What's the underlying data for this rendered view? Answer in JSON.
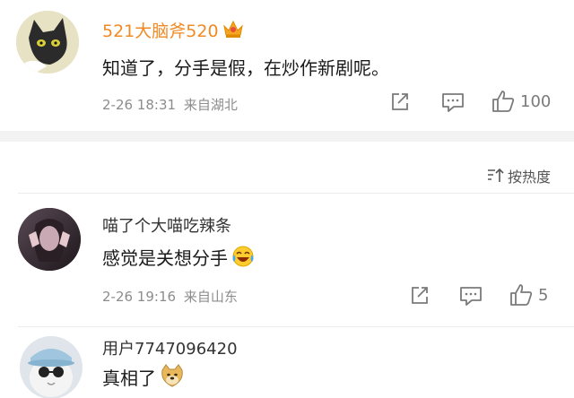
{
  "comments": [
    {
      "username": "521大脑斧520",
      "username_color": "#f08a24",
      "vip_badge": "crown-icon",
      "text": "知道了，分手是假，在炒作新剧呢。",
      "time": "2-26 18:31",
      "location": "来自湖北",
      "likes": "100"
    },
    {
      "username": "喵了个大喵吃辣条",
      "username_color": "#333333",
      "text": "感觉是关想分手",
      "emoji": "laughing-tears-emoji",
      "time": "2-26 19:16",
      "location": "来自山东",
      "likes": "5"
    },
    {
      "username": "用户7747096420",
      "username_color": "#333333",
      "text": "真相了",
      "emoji": "doge-emoji"
    }
  ],
  "sort": {
    "label": "按热度",
    "icon": "sort-icon"
  }
}
